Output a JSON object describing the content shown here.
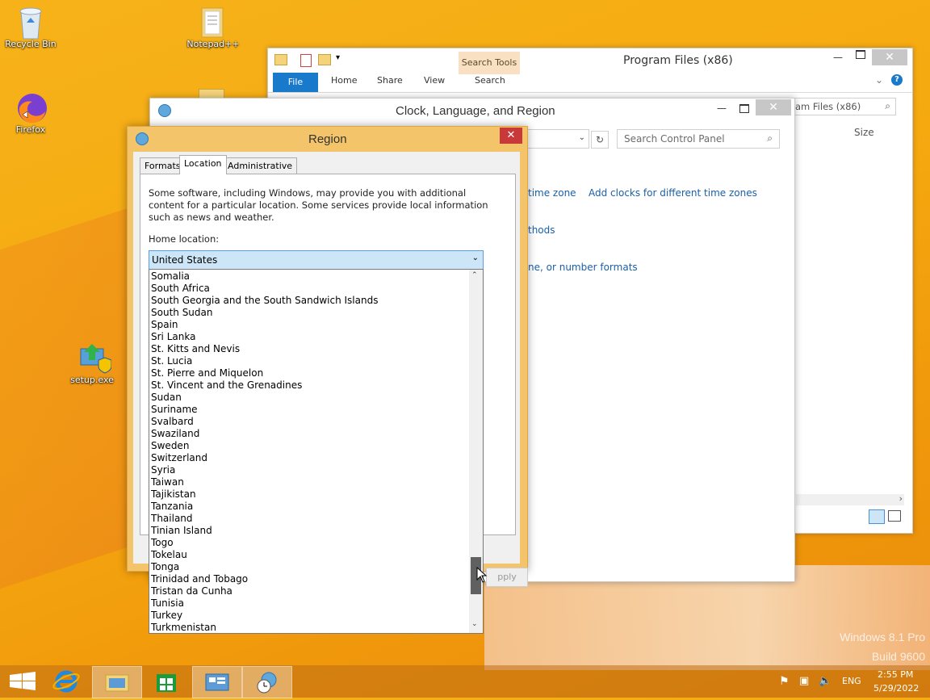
{
  "desktop": {
    "icons": [
      {
        "label": "Recycle Bin",
        "icon": "recycle-bin-icon"
      },
      {
        "label": "Notepad++",
        "icon": "folder-icon"
      },
      {
        "label": "Firefox",
        "icon": "firefox-icon"
      },
      {
        "label": "setup.exe",
        "icon": "setup-icon"
      }
    ],
    "watermark": {
      "line1": "Windows 8.1 Pro",
      "line2": "Build 9600"
    }
  },
  "explorer": {
    "title": "Program Files (x86)",
    "contextual_tab": "Search Tools",
    "tabs": [
      "File",
      "Home",
      "Share",
      "View",
      "Search"
    ],
    "search_value": "am Files (x86)",
    "column_size": "Size",
    "colors": {
      "file_tab": "#1979ca",
      "contextual": "#f9e0c2"
    }
  },
  "clock_window": {
    "title": "Clock, Language, and Region",
    "search_placeholder": "Search Control Panel",
    "links": [
      {
        "text": "time zone"
      },
      {
        "text": "Add clocks for different time zones"
      },
      {
        "text": "thods"
      },
      {
        "text": "ne, or number formats"
      }
    ]
  },
  "region_dialog": {
    "title": "Region",
    "tabs": [
      "Formats",
      "Location",
      "Administrative"
    ],
    "selected_tab": "Location",
    "description": "Some software, including Windows, may provide you with additional content for a particular location. Some services provide local information such as news and weather.",
    "home_location_label": "Home location:",
    "home_location_value": "United States",
    "apply_label": "pply",
    "dropdown_items": [
      "Somalia",
      "South Africa",
      "South Georgia and the South Sandwich Islands",
      "South Sudan",
      "Spain",
      "Sri Lanka",
      "St. Kitts and Nevis",
      "St. Lucia",
      "St. Pierre and Miquelon",
      "St. Vincent and the Grenadines",
      "Sudan",
      "Suriname",
      "Svalbard",
      "Swaziland",
      "Sweden",
      "Switzerland",
      "Syria",
      "Taiwan",
      "Tajikistan",
      "Tanzania",
      "Thailand",
      "Tinian Island",
      "Togo",
      "Tokelau",
      "Tonga",
      "Trinidad and Tobago",
      "Tristan da Cunha",
      "Tunisia",
      "Turkey",
      "Turkmenistan"
    ],
    "close_color": "#c9393a"
  },
  "taskbar": {
    "buttons": [
      "start-button",
      "internet-explorer",
      "file-explorer",
      "store",
      "control-panel",
      "region-settings"
    ],
    "tray": {
      "language": "ENG",
      "time": "2:55 PM",
      "date": "5/29/2022"
    }
  }
}
